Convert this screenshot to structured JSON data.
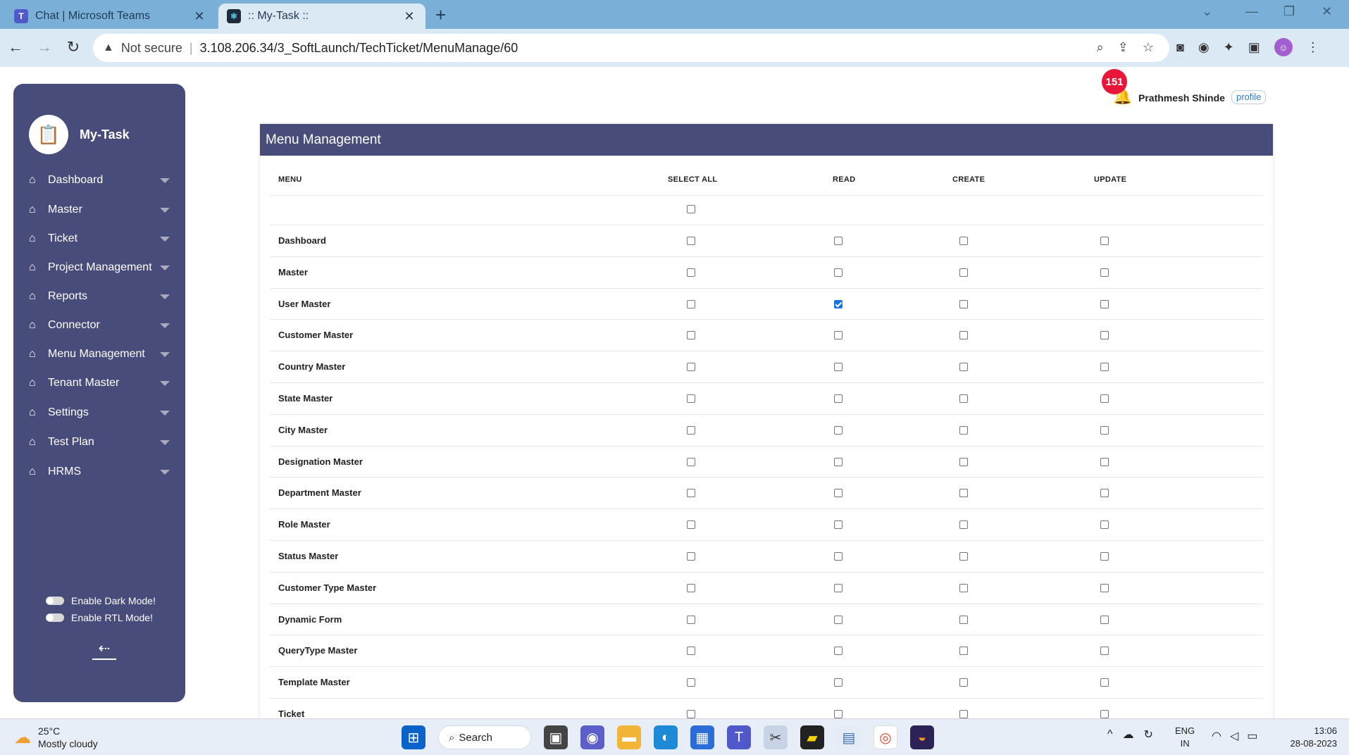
{
  "browser": {
    "tabs": [
      {
        "title": "Chat | Microsoft Teams",
        "icon": "teams-icon",
        "active": false
      },
      {
        "title": ":: My-Task ::",
        "icon": "react-icon",
        "active": true
      }
    ],
    "security_label": "Not secure",
    "url": "3.108.206.34/3_SoftLaunch/TechTicket/MenuManage/60"
  },
  "sidebar": {
    "brand": "My-Task",
    "items": [
      {
        "label": "Dashboard"
      },
      {
        "label": "Master"
      },
      {
        "label": "Ticket"
      },
      {
        "label": "Project Management"
      },
      {
        "label": "Reports"
      },
      {
        "label": "Connector"
      },
      {
        "label": "Menu Management"
      },
      {
        "label": "Tenant Master"
      },
      {
        "label": "Settings"
      },
      {
        "label": "Test Plan"
      },
      {
        "label": "HRMS"
      }
    ],
    "dark_mode_label": "Enable Dark Mode!",
    "rtl_mode_label": "Enable RTL Mode!"
  },
  "header": {
    "notification_count": "151",
    "user_name": "Prathmesh Shinde",
    "profile_alt": "profile"
  },
  "menu_management": {
    "title": "Menu Management",
    "columns": {
      "menu": "MENU",
      "select_all": "SELECT ALL",
      "read": "READ",
      "create": "CREATE",
      "update": "UPDATE"
    },
    "select_all_checked": false,
    "rows": [
      {
        "menu": "Dashboard",
        "select_all": false,
        "read": false,
        "create": false,
        "update": false
      },
      {
        "menu": "Master",
        "select_all": false,
        "read": false,
        "create": false,
        "update": false
      },
      {
        "menu": "User Master",
        "select_all": false,
        "read": true,
        "create": false,
        "update": false
      },
      {
        "menu": "Customer Master",
        "select_all": false,
        "read": false,
        "create": false,
        "update": false
      },
      {
        "menu": "Country Master",
        "select_all": false,
        "read": false,
        "create": false,
        "update": false
      },
      {
        "menu": "State Master",
        "select_all": false,
        "read": false,
        "create": false,
        "update": false
      },
      {
        "menu": "City Master",
        "select_all": false,
        "read": false,
        "create": false,
        "update": false
      },
      {
        "menu": "Designation Master",
        "select_all": false,
        "read": false,
        "create": false,
        "update": false
      },
      {
        "menu": "Department Master",
        "select_all": false,
        "read": false,
        "create": false,
        "update": false
      },
      {
        "menu": "Role Master",
        "select_all": false,
        "read": false,
        "create": false,
        "update": false
      },
      {
        "menu": "Status Master",
        "select_all": false,
        "read": false,
        "create": false,
        "update": false
      },
      {
        "menu": "Customer Type Master",
        "select_all": false,
        "read": false,
        "create": false,
        "update": false
      },
      {
        "menu": "Dynamic Form",
        "select_all": false,
        "read": false,
        "create": false,
        "update": false
      },
      {
        "menu": "QueryType Master",
        "select_all": false,
        "read": false,
        "create": false,
        "update": false
      },
      {
        "menu": "Template Master",
        "select_all": false,
        "read": false,
        "create": false,
        "update": false
      },
      {
        "menu": "Ticket",
        "select_all": false,
        "read": false,
        "create": false,
        "update": false
      }
    ]
  },
  "taskbar": {
    "temperature": "25°C",
    "weather": "Mostly cloudy",
    "search_label": "Search",
    "lang_line1": "ENG",
    "lang_line2": "IN",
    "time": "13:06",
    "date": "28-08-2023"
  },
  "colors": {
    "sidebar_bg": "#474c7b",
    "accent": "#474c7b",
    "badge": "#e8173a",
    "checkbox_checked": "#1a73e8"
  }
}
